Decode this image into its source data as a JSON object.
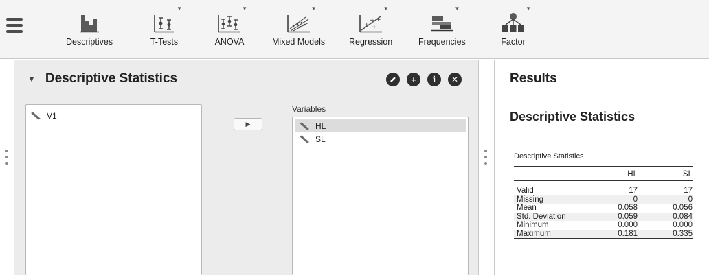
{
  "ribbon": {
    "items": [
      {
        "label": "Descriptives",
        "icon": "bar-chart-icon"
      },
      {
        "label": "T-Tests",
        "icon": "t-tests-icon"
      },
      {
        "label": "ANOVA",
        "icon": "anova-icon"
      },
      {
        "label": "Mixed Models",
        "icon": "mixed-models-icon"
      },
      {
        "label": "Regression",
        "icon": "regression-icon"
      },
      {
        "label": "Frequencies",
        "icon": "frequencies-icon"
      },
      {
        "label": "Factor",
        "icon": "factor-icon"
      }
    ]
  },
  "analysis": {
    "title": "Descriptive Statistics",
    "available_variables": [
      "V1"
    ],
    "variables_label": "Variables",
    "selected_variables": [
      "HL",
      "SL"
    ],
    "controls": [
      "edit-icon",
      "add-icon",
      "info-icon",
      "close-icon"
    ]
  },
  "results": {
    "heading": "Results",
    "section_title": "Descriptive Statistics",
    "table": {
      "caption": "Descriptive Statistics",
      "columns": [
        "",
        "HL",
        "SL"
      ],
      "rows": [
        [
          "Valid",
          "17",
          "17"
        ],
        [
          "Missing",
          "0",
          "0"
        ],
        [
          "Mean",
          "0.058",
          "0.056"
        ],
        [
          "Std. Deviation",
          "0.059",
          "0.084"
        ],
        [
          "Minimum",
          "0.000",
          "0.000"
        ],
        [
          "Maximum",
          "0.181",
          "0.335"
        ]
      ]
    }
  },
  "colors": {
    "ribbon_bg": "#f4f4f4",
    "pane_bg": "#ececec",
    "icon_dark": "#4d4d4d",
    "selection": "#dcdcdc"
  }
}
